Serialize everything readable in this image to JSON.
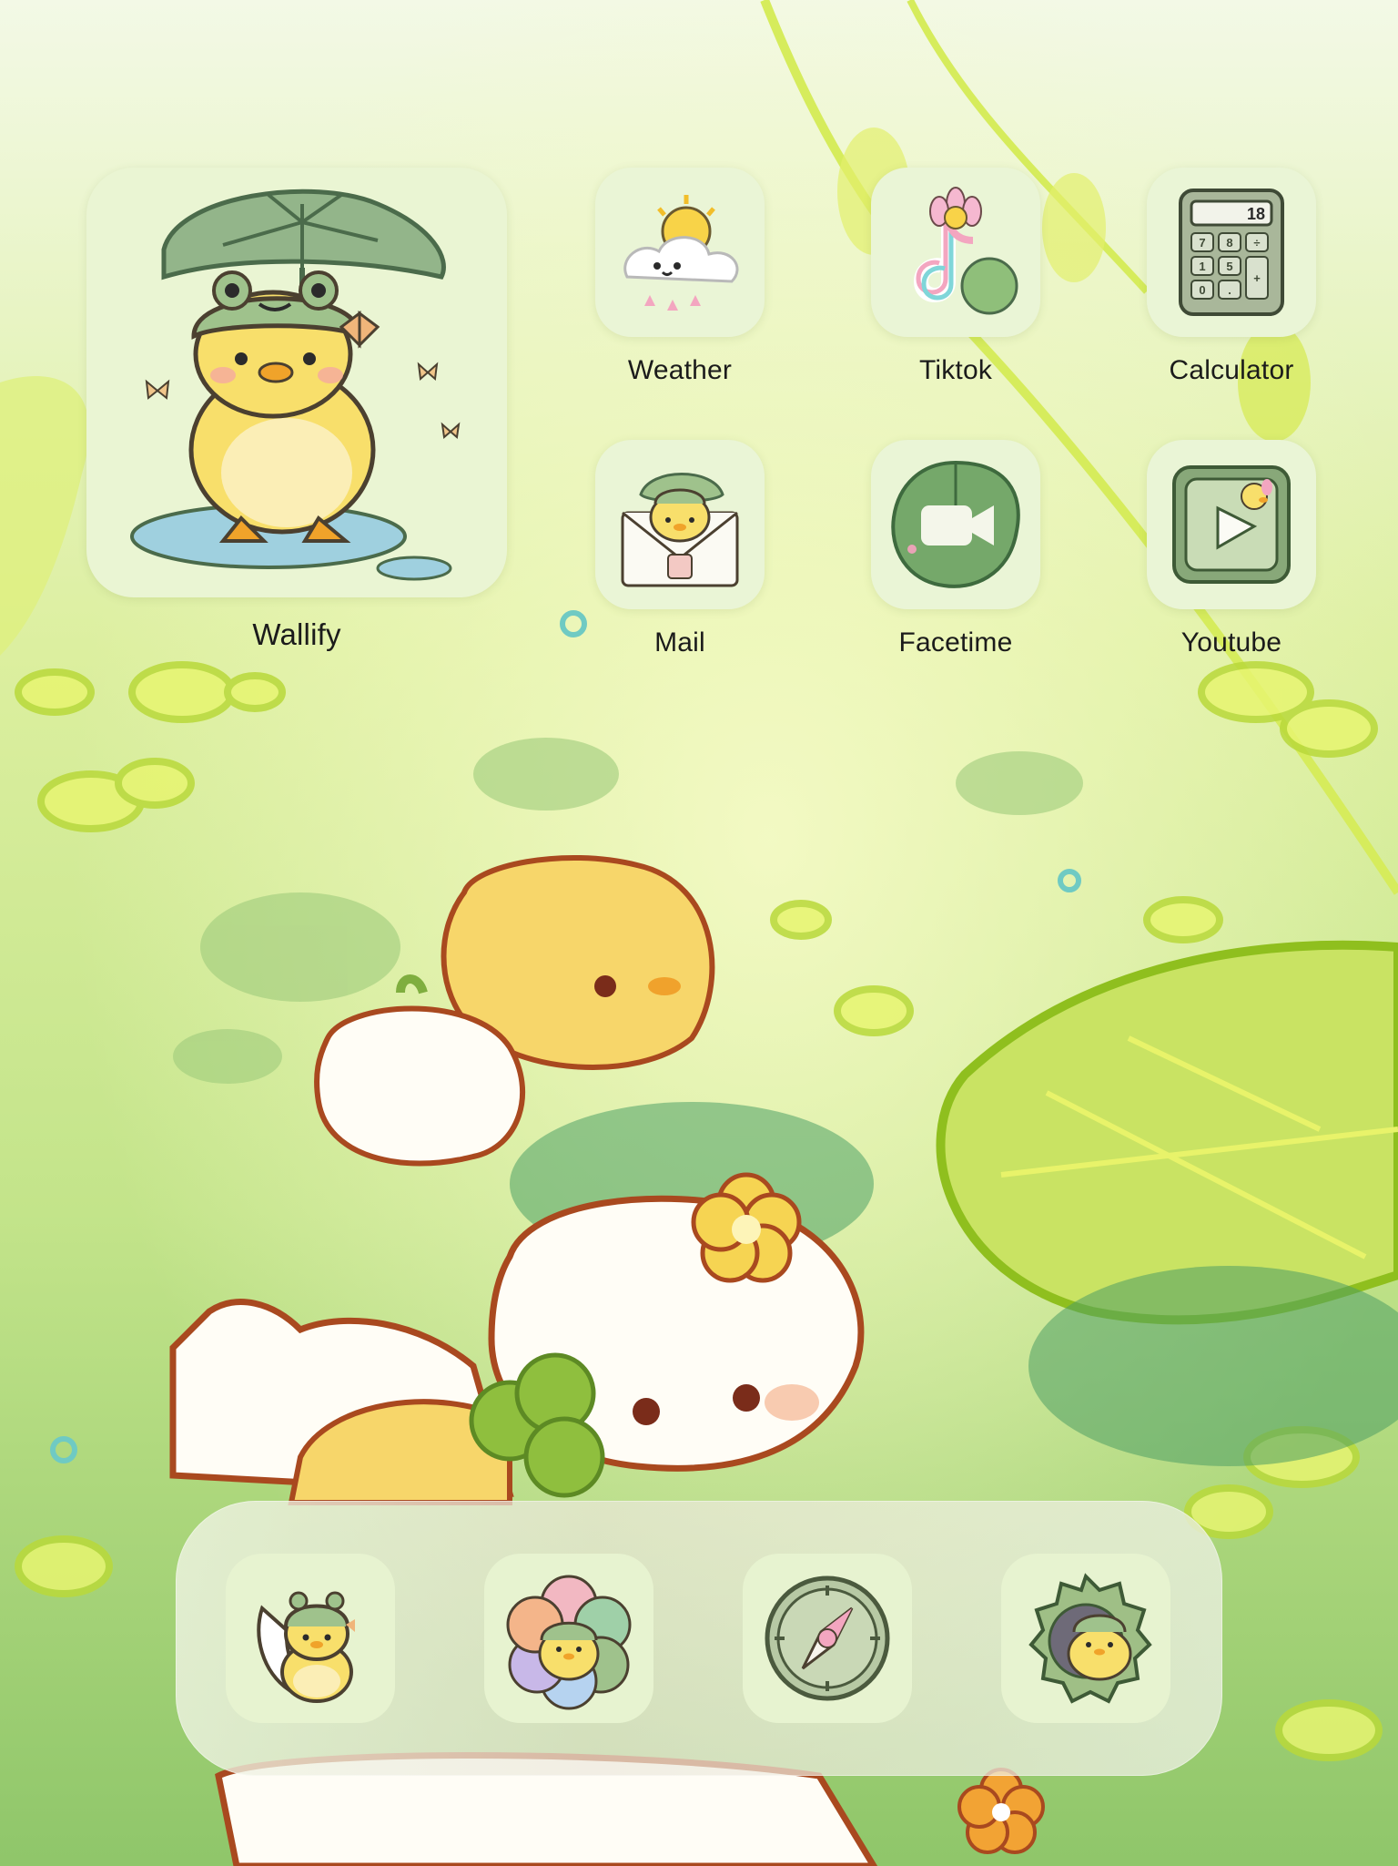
{
  "theme": {
    "accent": "#a6cf3f",
    "tile_bg": "#eaf5d6",
    "label_color": "#1b1b1b"
  },
  "widget": {
    "label": "Wallify",
    "icon": "duck-with-leaf-umbrella-icon"
  },
  "apps": [
    {
      "label": "Weather",
      "icon": "weather-icon"
    },
    {
      "label": "Tiktok",
      "icon": "tiktok-icon"
    },
    {
      "label": "Calculator",
      "icon": "calculator-icon"
    },
    {
      "label": "Mail",
      "icon": "mail-icon"
    },
    {
      "label": "Facetime",
      "icon": "facetime-icon"
    },
    {
      "label": "Youtube",
      "icon": "youtube-icon"
    }
  ],
  "calculator_display": "18",
  "calculator_keys": [
    "7",
    "8",
    "÷",
    "1",
    "5",
    "+",
    "0",
    "."
  ],
  "dock": [
    {
      "icon": "phone-icon"
    },
    {
      "icon": "photos-icon"
    },
    {
      "icon": "compass-icon"
    },
    {
      "icon": "settings-icon"
    }
  ]
}
